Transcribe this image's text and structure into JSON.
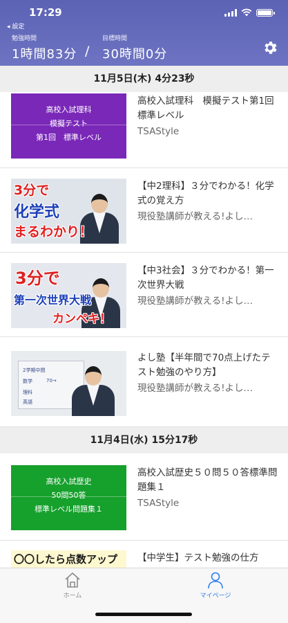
{
  "status_bar": {
    "time": "17:29"
  },
  "header": {
    "back_label": "◂ 設定",
    "study_time_label": "勉強時間",
    "study_time_value": "1時間83分",
    "separator": "/",
    "goal_time_label": "目標時間",
    "goal_time_value": "30時間0分",
    "settings_icon": "gear-icon"
  },
  "sections": [
    {
      "date": "11月5日(木) 4分23秒",
      "videos": [
        {
          "title": "高校入試理科　模擬テスト第1回　標準レベル",
          "channel": "TSAStyle",
          "thumb_lines": [
            "高校入試理科",
            "模擬テスト",
            "第1回　標準レベル"
          ]
        },
        {
          "title": "【中2理科】３分でわかる！化学式の覚え方",
          "channel": "現役塾講師が教える!よし…",
          "thumb_lines": [
            "3分で",
            "化学式",
            "まるわかり！"
          ]
        },
        {
          "title": "【中3社会】３分でわかる！第一次世界大戦",
          "channel": "現役塾講師が教える!よし…",
          "thumb_lines": [
            "3分で",
            "第一次世界大戦",
            "カンペキ！"
          ]
        },
        {
          "title": "よし塾【半年間で70点上げたテスト勉強のやり方】",
          "channel": "現役塾講師が教える!よし…",
          "thumb_lines": []
        }
      ]
    },
    {
      "date": "11月4日(水) 15分17秒",
      "videos": [
        {
          "title": "高校入試歴史５０問５０答標準問題集１",
          "channel": "TSAStyle",
          "thumb_lines": [
            "高校入試歴史",
            "50問50答",
            "標準レベル問題集１"
          ]
        },
        {
          "title": "【中学生】テスト勉強の仕方",
          "channel": "",
          "thumb_lines": [
            "〇〇したら点数アップ"
          ]
        }
      ]
    }
  ],
  "tabbar": {
    "home_label": "ホーム",
    "mypage_label": "マイページ",
    "active_color": "#2d7df0",
    "inactive_color": "#8a8a8a"
  },
  "colors": {
    "header": "#6268b8",
    "purple_thumb": "#7a28b8",
    "green_thumb": "#16a02c"
  }
}
